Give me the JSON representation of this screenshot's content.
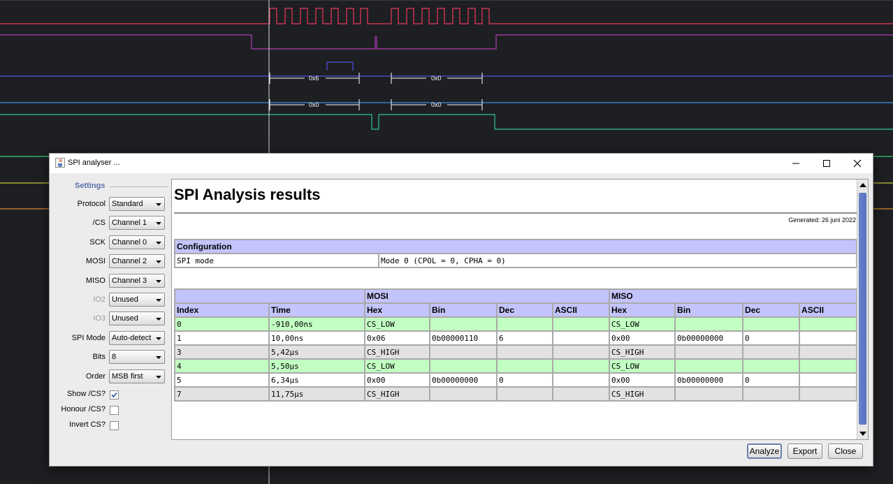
{
  "window": {
    "title": "SPI analyser ..."
  },
  "settings": {
    "legend": "Settings",
    "rows": [
      {
        "label": "Protocol",
        "value": "Standard",
        "enabled": true
      },
      {
        "label": "/CS",
        "value": "Channel 1",
        "enabled": true
      },
      {
        "label": "SCK",
        "value": "Channel 0",
        "enabled": true
      },
      {
        "label": "MOSI",
        "value": "Channel 2",
        "enabled": true
      },
      {
        "label": "MISO",
        "value": "Channel 3",
        "enabled": true
      },
      {
        "label": "IO2",
        "value": "Unused",
        "enabled": false
      },
      {
        "label": "IO3",
        "value": "Unused",
        "enabled": false
      },
      {
        "label": "SPI Mode",
        "value": "Auto-detect",
        "enabled": true
      },
      {
        "label": "Bits",
        "value": "8",
        "enabled": true
      },
      {
        "label": "Order",
        "value": "MSB first",
        "enabled": true
      }
    ],
    "checks": [
      {
        "label": "Show /CS?",
        "checked": true
      },
      {
        "label": "Honour /CS?",
        "checked": false
      },
      {
        "label": "Invert CS?",
        "checked": false
      }
    ]
  },
  "report": {
    "title": "SPI Analysis results",
    "generated": "Generated: 26 juni 2022",
    "config_header": "Configuration",
    "config_key": "SPI mode",
    "config_value": "Mode 0 (CPOL = 0, CPHA = 0)",
    "groups": {
      "mosi": "MOSI",
      "miso": "MISO"
    },
    "columns": [
      "Index",
      "Time",
      "Hex",
      "Bin",
      "Dec",
      "ASCII",
      "Hex",
      "Bin",
      "Dec",
      "ASCII"
    ],
    "rows": [
      {
        "style": "green",
        "cells": [
          "0",
          "-910,00ns",
          "CS_LOW",
          "",
          "",
          "",
          "CS_LOW",
          "",
          "",
          ""
        ]
      },
      {
        "style": "white",
        "cells": [
          "1",
          "10,00ns",
          "0x06",
          "0b00000110",
          "6",
          "",
          "0x00",
          "0b00000000",
          "0",
          ""
        ]
      },
      {
        "style": "gray",
        "cells": [
          "3",
          "5,42µs",
          "CS_HIGH",
          "",
          "",
          "",
          "CS_HIGH",
          "",
          "",
          ""
        ]
      },
      {
        "style": "green",
        "cells": [
          "4",
          "5,50µs",
          "CS_LOW",
          "",
          "",
          "",
          "CS_LOW",
          "",
          "",
          ""
        ]
      },
      {
        "style": "white",
        "cells": [
          "5",
          "6,34µs",
          "0x00",
          "0b00000000",
          "0",
          "",
          "0x00",
          "0b00000000",
          "0",
          ""
        ]
      },
      {
        "style": "gray",
        "cells": [
          "7",
          "11,75µs",
          "CS_HIGH",
          "",
          "",
          "",
          "CS_HIGH",
          "",
          "",
          ""
        ]
      }
    ]
  },
  "buttons": {
    "analyze": "Analyze",
    "export": "Export",
    "close": "Close"
  },
  "waveform": {
    "mosi_labels": [
      "0x6",
      "0x0"
    ],
    "miso_labels": [
      "0x0",
      "0x0"
    ],
    "channel_colors": [
      "#e83a5a",
      "#b43ab4",
      "#5050e0",
      "#3a8fe8",
      "#2ec4a0",
      "#3ad070",
      "#c8c840",
      "#e08a30"
    ]
  },
  "colors": {
    "header_bg": "#c4c4fc",
    "row_green": "#c2ffc2",
    "row_gray": "#e2e2e2",
    "accent": "#5470c0"
  }
}
